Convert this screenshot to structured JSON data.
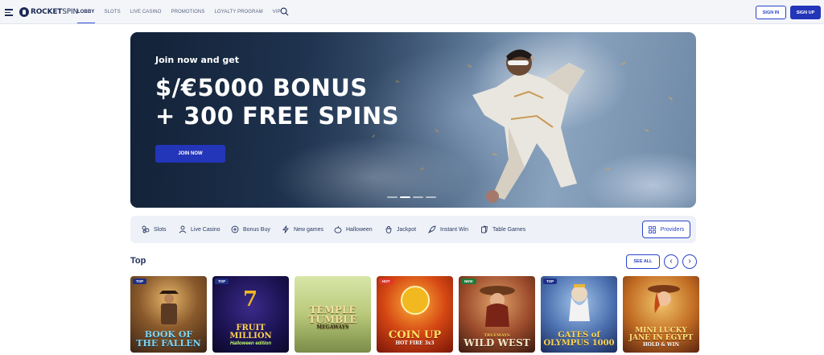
{
  "header": {
    "logo": {
      "bold": "ROCKET",
      "rest": "SPIN"
    },
    "nav": [
      {
        "label": "LOBBY",
        "active": true
      },
      {
        "label": "SLOTS",
        "active": false
      },
      {
        "label": "LIVE CASINO",
        "active": false
      },
      {
        "label": "PROMOTIONS",
        "active": false
      },
      {
        "label": "LOYALTY PROGRAM",
        "active": false
      },
      {
        "label": "VIP",
        "active": false
      }
    ],
    "sign_in": "SIGN IN",
    "sign_up": "SIGN UP"
  },
  "hero": {
    "pre_title": "Join now and get",
    "title_line1": "$/€5000 BONUS",
    "title_line2": "+ 300 FREE SPINS",
    "cta": "JOIN NOW",
    "slides": 4,
    "active_slide": 2
  },
  "categories": [
    {
      "label": "Slots",
      "icon": "slot-icon"
    },
    {
      "label": "Live Casino",
      "icon": "dealer-icon"
    },
    {
      "label": "Bonus Buy",
      "icon": "bonus-buy-icon"
    },
    {
      "label": "New games",
      "icon": "lightning-icon"
    },
    {
      "label": "Halloween",
      "icon": "pumpkin-icon"
    },
    {
      "label": "Jackpot",
      "icon": "jackpot-icon"
    },
    {
      "label": "Instant Win",
      "icon": "rocket-icon"
    },
    {
      "label": "Table Games",
      "icon": "cards-icon"
    }
  ],
  "providers_label": "Providers",
  "top_section": {
    "title": "Top",
    "see_all": "SEE ALL",
    "prev": "‹",
    "next": "›",
    "games": [
      {
        "title": "BOOK OF THE FALLEN",
        "subtitle": "",
        "badge": "TOP"
      },
      {
        "title": "FRUIT MILLION",
        "subtitle": "Halloween edition",
        "badge": "TOP"
      },
      {
        "title": "TEMPLE TUMBLE",
        "subtitle": "MEGAWAYS",
        "badge": ""
      },
      {
        "title": "COIN UP",
        "subtitle": "HOT FIRE 3x3",
        "badge": "HOT"
      },
      {
        "title": "WILD WEST",
        "subtitle": "TRUEWAYS",
        "badge": "NEW"
      },
      {
        "title": "GATES of OLYMPUS 1000",
        "subtitle": "",
        "badge": "TOP"
      },
      {
        "title": "MINI LUCKY JANE IN EGYPT",
        "subtitle": "HOLD & WIN",
        "badge": ""
      }
    ]
  },
  "colors": {
    "primary": "#2335b9",
    "text_dark": "#1d2a55",
    "badge": "#1e2f86",
    "category_bar": "#eef2f8"
  }
}
